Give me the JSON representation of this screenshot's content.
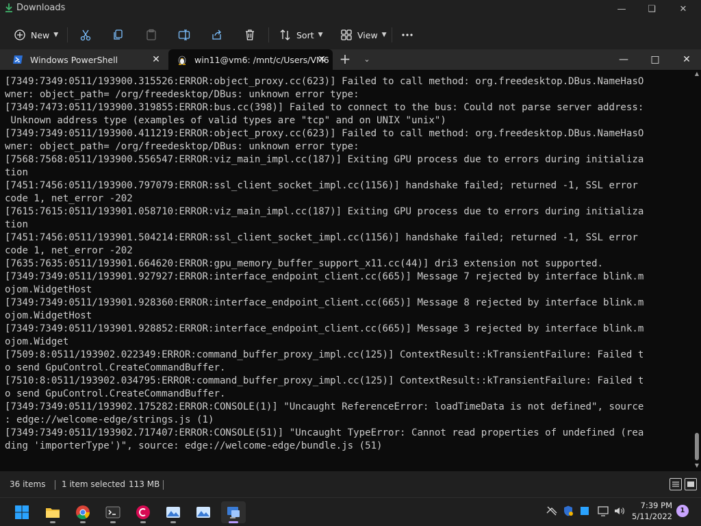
{
  "explorer": {
    "title": "Downloads",
    "toolbar": {
      "new_label": "New",
      "sort_label": "Sort",
      "view_label": "View"
    },
    "status": {
      "item_count": "36 items",
      "selection": "1 item selected",
      "size": "113 MB"
    }
  },
  "terminal": {
    "tabs": [
      {
        "label": "Windows PowerShell",
        "active": false
      },
      {
        "label": "win11@vm6: /mnt/c/Users/VM6",
        "active": true
      }
    ],
    "lines": [
      "[7349:7349:0511/193900.315526:ERROR:object_proxy.cc(623)] Failed to call method: org.freedesktop.DBus.NameHasO",
      "wner: object_path= /org/freedesktop/DBus: unknown error type:",
      "[7349:7473:0511/193900.319855:ERROR:bus.cc(398)] Failed to connect to the bus: Could not parse server address:",
      " Unknown address type (examples of valid types are \"tcp\" and on UNIX \"unix\")",
      "[7349:7349:0511/193900.411219:ERROR:object_proxy.cc(623)] Failed to call method: org.freedesktop.DBus.NameHasO",
      "wner: object_path= /org/freedesktop/DBus: unknown error type:",
      "[7568:7568:0511/193900.556547:ERROR:viz_main_impl.cc(187)] Exiting GPU process due to errors during initializa",
      "tion",
      "[7451:7456:0511/193900.797079:ERROR:ssl_client_socket_impl.cc(1156)] handshake failed; returned -1, SSL error",
      "code 1, net_error -202",
      "[7615:7615:0511/193901.058710:ERROR:viz_main_impl.cc(187)] Exiting GPU process due to errors during initializa",
      "tion",
      "[7451:7456:0511/193901.504214:ERROR:ssl_client_socket_impl.cc(1156)] handshake failed; returned -1, SSL error",
      "code 1, net_error -202",
      "[7635:7635:0511/193901.664620:ERROR:gpu_memory_buffer_support_x11.cc(44)] dri3 extension not supported.",
      "[7349:7349:0511/193901.927927:ERROR:interface_endpoint_client.cc(665)] Message 7 rejected by interface blink.m",
      "ojom.WidgetHost",
      "[7349:7349:0511/193901.928360:ERROR:interface_endpoint_client.cc(665)] Message 8 rejected by interface blink.m",
      "ojom.WidgetHost",
      "[7349:7349:0511/193901.928852:ERROR:interface_endpoint_client.cc(665)] Message 3 rejected by interface blink.m",
      "ojom.Widget",
      "[7509:8:0511/193902.022349:ERROR:command_buffer_proxy_impl.cc(125)] ContextResult::kTransientFailure: Failed t",
      "o send GpuControl.CreateCommandBuffer.",
      "[7510:8:0511/193902.034795:ERROR:command_buffer_proxy_impl.cc(125)] ContextResult::kTransientFailure: Failed t",
      "o send GpuControl.CreateCommandBuffer.",
      "[7349:7349:0511/193902.175282:ERROR:CONSOLE(1)] \"Uncaught ReferenceError: loadTimeData is not defined\", source",
      ": edge://welcome-edge/strings.js (1)",
      "[7349:7349:0511/193902.717407:ERROR:CONSOLE(51)] \"Uncaught TypeError: Cannot read properties of undefined (rea",
      "ding 'importerType')\", source: edge://welcome-edge/bundle.js (51)"
    ]
  },
  "taskbar": {
    "time": "7:39 PM",
    "date": "5/11/2022",
    "notification_count": "1",
    "apps": [
      "start-icon",
      "file-explorer-icon",
      "chrome-icon",
      "terminal-icon",
      "debian-icon",
      "photos-icon",
      "photos-icon",
      "remote-desktop-icon"
    ]
  },
  "colors": {
    "terminal_bg": "#0c0c0c",
    "terminal_fg": "#cccccc",
    "chrome_bg": "#202020",
    "tab_strip_bg": "#2b2b2b",
    "accent_purple": "#b79cff"
  }
}
